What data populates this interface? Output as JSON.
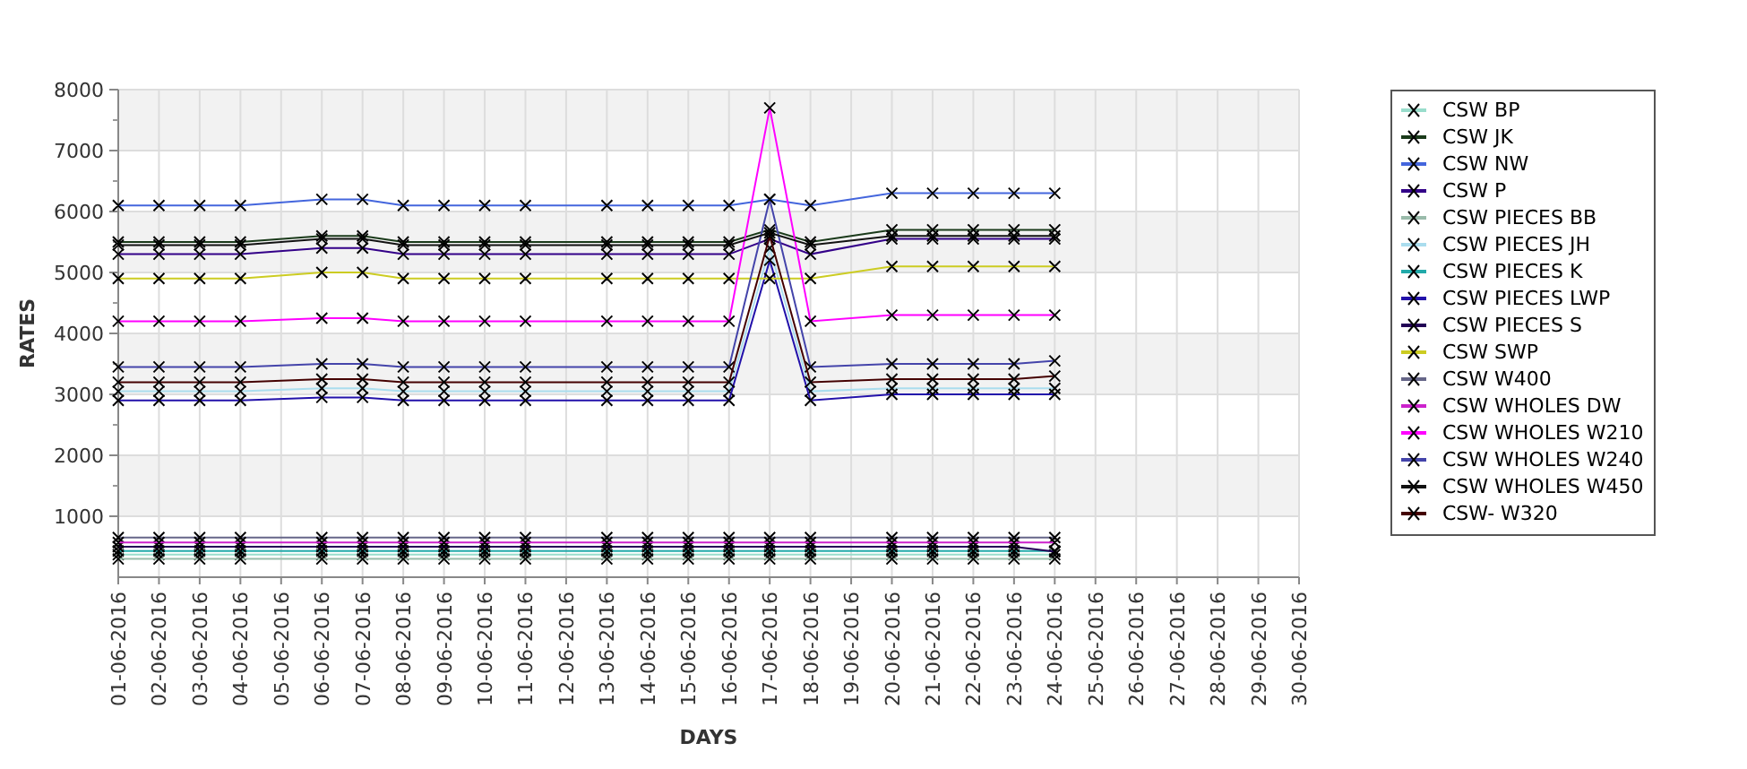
{
  "chart_data": {
    "type": "line",
    "xlabel": "DAYS",
    "ylabel": "RATES",
    "categories": [
      "01-06-2016",
      "02-06-2016",
      "03-06-2016",
      "04-06-2016",
      "05-06-2016",
      "06-06-2016",
      "07-06-2016",
      "08-06-2016",
      "09-06-2016",
      "10-06-2016",
      "11-06-2016",
      "12-06-2016",
      "13-06-2016",
      "14-06-2016",
      "15-06-2016",
      "16-06-2016",
      "17-06-2016",
      "18-06-2016",
      "19-06-2016",
      "20-06-2016",
      "21-06-2016",
      "22-06-2016",
      "23-06-2016",
      "24-06-2016",
      "25-06-2016",
      "26-06-2016",
      "27-06-2016",
      "28-06-2016",
      "29-06-2016",
      "30-06-2016"
    ],
    "ylim": [
      0,
      8000
    ],
    "grid": true,
    "legend": true,
    "yticks": [
      1000,
      2000,
      3000,
      4000,
      5000,
      6000,
      7000,
      8000
    ],
    "series": [
      {
        "name": "CSW BP",
        "color": "#99ddcc",
        "marker": "x",
        "values": [
          370,
          370,
          370,
          370,
          null,
          370,
          370,
          370,
          370,
          370,
          370,
          null,
          370,
          370,
          370,
          370,
          370,
          370,
          null,
          370,
          370,
          370,
          370,
          370,
          null,
          null,
          null,
          null,
          null,
          null
        ]
      },
      {
        "name": "CSW JK",
        "color": "#1a3a1a",
        "marker": "x",
        "values": [
          5500,
          5500,
          5500,
          5500,
          null,
          5600,
          5600,
          5500,
          5500,
          5500,
          5500,
          null,
          5500,
          5500,
          5500,
          5500,
          5700,
          5500,
          null,
          5700,
          5700,
          5700,
          5700,
          5700,
          null,
          null,
          null,
          null,
          null,
          null
        ]
      },
      {
        "name": "CSW NW",
        "color": "#4466dd",
        "marker": "x",
        "values": [
          6100,
          6100,
          6100,
          6100,
          null,
          6200,
          6200,
          6100,
          6100,
          6100,
          6100,
          null,
          6100,
          6100,
          6100,
          6100,
          6200,
          6100,
          null,
          6300,
          6300,
          6300,
          6300,
          6300,
          null,
          null,
          null,
          null,
          null,
          null
        ]
      },
      {
        "name": "CSW P",
        "color": "#330088",
        "marker": "x",
        "values": [
          5300,
          5300,
          5300,
          5300,
          null,
          5400,
          5400,
          5300,
          5300,
          5300,
          5300,
          null,
          5300,
          5300,
          5300,
          5300,
          5550,
          5300,
          null,
          5550,
          5550,
          5550,
          5550,
          5550,
          null,
          null,
          null,
          null,
          null,
          null
        ]
      },
      {
        "name": "CSW PIECES BB",
        "color": "#99bbaa",
        "marker": "x",
        "values": [
          300,
          300,
          300,
          300,
          null,
          300,
          300,
          300,
          300,
          300,
          300,
          null,
          300,
          300,
          300,
          300,
          300,
          300,
          null,
          300,
          300,
          300,
          300,
          300,
          null,
          null,
          null,
          null,
          null,
          null
        ]
      },
      {
        "name": "CSW PIECES JH",
        "color": "#aaddee",
        "marker": "x",
        "values": [
          3050,
          3050,
          3050,
          3050,
          null,
          3100,
          3100,
          3050,
          3050,
          3050,
          3050,
          null,
          3050,
          3050,
          3050,
          3050,
          5400,
          3050,
          null,
          3100,
          3100,
          3100,
          3100,
          3100,
          null,
          null,
          null,
          null,
          null,
          null
        ]
      },
      {
        "name": "CSW PIECES K",
        "color": "#22aaaa",
        "marker": "x",
        "values": [
          430,
          430,
          430,
          430,
          null,
          430,
          430,
          430,
          430,
          430,
          430,
          null,
          430,
          430,
          430,
          430,
          430,
          430,
          null,
          430,
          430,
          430,
          430,
          430,
          null,
          null,
          null,
          null,
          null,
          null
        ]
      },
      {
        "name": "CSW PIECES LWP",
        "color": "#2211aa",
        "marker": "x",
        "values": [
          2900,
          2900,
          2900,
          2900,
          null,
          2950,
          2950,
          2900,
          2900,
          2900,
          2900,
          null,
          2900,
          2900,
          2900,
          2900,
          5200,
          2900,
          null,
          3000,
          3000,
          3000,
          3000,
          3000,
          null,
          null,
          null,
          null,
          null,
          null
        ]
      },
      {
        "name": "CSW PIECES S",
        "color": "#220055",
        "marker": "x",
        "values": [
          500,
          500,
          500,
          500,
          null,
          500,
          500,
          500,
          500,
          500,
          500,
          null,
          500,
          500,
          500,
          500,
          500,
          500,
          null,
          500,
          500,
          500,
          500,
          420,
          null,
          null,
          null,
          null,
          null,
          null
        ]
      },
      {
        "name": "CSW SWP",
        "color": "#cccc22",
        "marker": "x",
        "values": [
          4900,
          4900,
          4900,
          4900,
          null,
          5000,
          5000,
          4900,
          4900,
          4900,
          4900,
          null,
          4900,
          4900,
          4900,
          4900,
          4900,
          4900,
          null,
          5100,
          5100,
          5100,
          5100,
          5100,
          null,
          null,
          null,
          null,
          null,
          null
        ]
      },
      {
        "name": "CSW W400",
        "color": "#666688",
        "marker": "x",
        "values": [
          650,
          650,
          650,
          650,
          null,
          650,
          650,
          650,
          650,
          650,
          650,
          null,
          650,
          650,
          650,
          650,
          650,
          650,
          null,
          650,
          650,
          650,
          650,
          650,
          null,
          null,
          null,
          null,
          null,
          null
        ]
      },
      {
        "name": "CSW WHOLES DW",
        "color": "#cc22cc",
        "marker": "x",
        "values": [
          570,
          570,
          570,
          570,
          null,
          570,
          570,
          570,
          570,
          570,
          570,
          null,
          570,
          570,
          570,
          570,
          570,
          570,
          null,
          570,
          570,
          570,
          570,
          570,
          null,
          null,
          null,
          null,
          null,
          null
        ]
      },
      {
        "name": "CSW WHOLES W210",
        "color": "#ff00ff",
        "marker": "x",
        "values": [
          4200,
          4200,
          4200,
          4200,
          null,
          4250,
          4250,
          4200,
          4200,
          4200,
          4200,
          null,
          4200,
          4200,
          4200,
          4200,
          7700,
          4200,
          null,
          4300,
          4300,
          4300,
          4300,
          4300,
          null,
          null,
          null,
          null,
          null,
          null
        ]
      },
      {
        "name": "CSW WHOLES W240",
        "color": "#4444aa",
        "marker": "x",
        "values": [
          3450,
          3450,
          3450,
          3450,
          null,
          3500,
          3500,
          3450,
          3450,
          3450,
          3450,
          null,
          3450,
          3450,
          3450,
          3450,
          6200,
          3450,
          null,
          3500,
          3500,
          3500,
          3500,
          3550,
          null,
          null,
          null,
          null,
          null,
          null
        ]
      },
      {
        "name": "CSW WHOLES W450",
        "color": "#111111",
        "marker": "x",
        "values": [
          5450,
          5450,
          5450,
          5450,
          null,
          5550,
          5550,
          5450,
          5450,
          5450,
          5450,
          null,
          5450,
          5450,
          5450,
          5450,
          5650,
          5450,
          null,
          5600,
          5600,
          5600,
          5600,
          5600,
          null,
          null,
          null,
          null,
          null,
          null
        ]
      },
      {
        "name": "CSW- W320",
        "color": "#440000",
        "marker": "x",
        "values": [
          3200,
          3200,
          3200,
          3200,
          null,
          3250,
          3250,
          3200,
          3200,
          3200,
          3200,
          null,
          3200,
          3200,
          3200,
          3200,
          5600,
          3200,
          null,
          3250,
          3250,
          3250,
          3250,
          3300,
          null,
          null,
          null,
          null,
          null,
          null
        ]
      }
    ]
  }
}
